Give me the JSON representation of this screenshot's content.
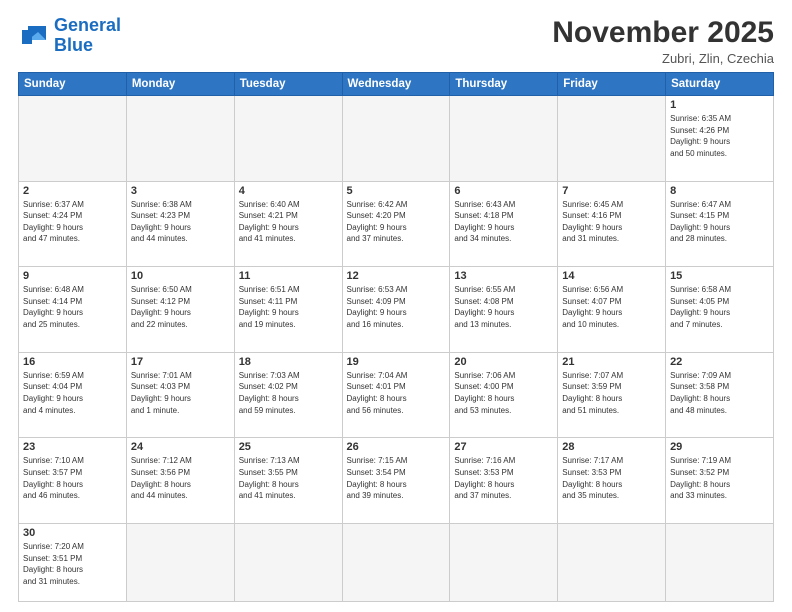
{
  "logo": {
    "general": "General",
    "blue": "Blue"
  },
  "header": {
    "month_year": "November 2025",
    "location": "Zubri, Zlin, Czechia"
  },
  "weekdays": [
    "Sunday",
    "Monday",
    "Tuesday",
    "Wednesday",
    "Thursday",
    "Friday",
    "Saturday"
  ],
  "weeks": [
    [
      {
        "day": "",
        "info": "",
        "empty": true
      },
      {
        "day": "",
        "info": "",
        "empty": true
      },
      {
        "day": "",
        "info": "",
        "empty": true
      },
      {
        "day": "",
        "info": "",
        "empty": true
      },
      {
        "day": "",
        "info": "",
        "empty": true
      },
      {
        "day": "",
        "info": "",
        "empty": true
      },
      {
        "day": "1",
        "info": "Sunrise: 6:35 AM\nSunset: 4:26 PM\nDaylight: 9 hours\nand 50 minutes.",
        "empty": false
      }
    ],
    [
      {
        "day": "2",
        "info": "Sunrise: 6:37 AM\nSunset: 4:24 PM\nDaylight: 9 hours\nand 47 minutes.",
        "empty": false
      },
      {
        "day": "3",
        "info": "Sunrise: 6:38 AM\nSunset: 4:23 PM\nDaylight: 9 hours\nand 44 minutes.",
        "empty": false
      },
      {
        "day": "4",
        "info": "Sunrise: 6:40 AM\nSunset: 4:21 PM\nDaylight: 9 hours\nand 41 minutes.",
        "empty": false
      },
      {
        "day": "5",
        "info": "Sunrise: 6:42 AM\nSunset: 4:20 PM\nDaylight: 9 hours\nand 37 minutes.",
        "empty": false
      },
      {
        "day": "6",
        "info": "Sunrise: 6:43 AM\nSunset: 4:18 PM\nDaylight: 9 hours\nand 34 minutes.",
        "empty": false
      },
      {
        "day": "7",
        "info": "Sunrise: 6:45 AM\nSunset: 4:16 PM\nDaylight: 9 hours\nand 31 minutes.",
        "empty": false
      },
      {
        "day": "8",
        "info": "Sunrise: 6:47 AM\nSunset: 4:15 PM\nDaylight: 9 hours\nand 28 minutes.",
        "empty": false
      }
    ],
    [
      {
        "day": "9",
        "info": "Sunrise: 6:48 AM\nSunset: 4:14 PM\nDaylight: 9 hours\nand 25 minutes.",
        "empty": false
      },
      {
        "day": "10",
        "info": "Sunrise: 6:50 AM\nSunset: 4:12 PM\nDaylight: 9 hours\nand 22 minutes.",
        "empty": false
      },
      {
        "day": "11",
        "info": "Sunrise: 6:51 AM\nSunset: 4:11 PM\nDaylight: 9 hours\nand 19 minutes.",
        "empty": false
      },
      {
        "day": "12",
        "info": "Sunrise: 6:53 AM\nSunset: 4:09 PM\nDaylight: 9 hours\nand 16 minutes.",
        "empty": false
      },
      {
        "day": "13",
        "info": "Sunrise: 6:55 AM\nSunset: 4:08 PM\nDaylight: 9 hours\nand 13 minutes.",
        "empty": false
      },
      {
        "day": "14",
        "info": "Sunrise: 6:56 AM\nSunset: 4:07 PM\nDaylight: 9 hours\nand 10 minutes.",
        "empty": false
      },
      {
        "day": "15",
        "info": "Sunrise: 6:58 AM\nSunset: 4:05 PM\nDaylight: 9 hours\nand 7 minutes.",
        "empty": false
      }
    ],
    [
      {
        "day": "16",
        "info": "Sunrise: 6:59 AM\nSunset: 4:04 PM\nDaylight: 9 hours\nand 4 minutes.",
        "empty": false
      },
      {
        "day": "17",
        "info": "Sunrise: 7:01 AM\nSunset: 4:03 PM\nDaylight: 9 hours\nand 1 minute.",
        "empty": false
      },
      {
        "day": "18",
        "info": "Sunrise: 7:03 AM\nSunset: 4:02 PM\nDaylight: 8 hours\nand 59 minutes.",
        "empty": false
      },
      {
        "day": "19",
        "info": "Sunrise: 7:04 AM\nSunset: 4:01 PM\nDaylight: 8 hours\nand 56 minutes.",
        "empty": false
      },
      {
        "day": "20",
        "info": "Sunrise: 7:06 AM\nSunset: 4:00 PM\nDaylight: 8 hours\nand 53 minutes.",
        "empty": false
      },
      {
        "day": "21",
        "info": "Sunrise: 7:07 AM\nSunset: 3:59 PM\nDaylight: 8 hours\nand 51 minutes.",
        "empty": false
      },
      {
        "day": "22",
        "info": "Sunrise: 7:09 AM\nSunset: 3:58 PM\nDaylight: 8 hours\nand 48 minutes.",
        "empty": false
      }
    ],
    [
      {
        "day": "23",
        "info": "Sunrise: 7:10 AM\nSunset: 3:57 PM\nDaylight: 8 hours\nand 46 minutes.",
        "empty": false
      },
      {
        "day": "24",
        "info": "Sunrise: 7:12 AM\nSunset: 3:56 PM\nDaylight: 8 hours\nand 44 minutes.",
        "empty": false
      },
      {
        "day": "25",
        "info": "Sunrise: 7:13 AM\nSunset: 3:55 PM\nDaylight: 8 hours\nand 41 minutes.",
        "empty": false
      },
      {
        "day": "26",
        "info": "Sunrise: 7:15 AM\nSunset: 3:54 PM\nDaylight: 8 hours\nand 39 minutes.",
        "empty": false
      },
      {
        "day": "27",
        "info": "Sunrise: 7:16 AM\nSunset: 3:53 PM\nDaylight: 8 hours\nand 37 minutes.",
        "empty": false
      },
      {
        "day": "28",
        "info": "Sunrise: 7:17 AM\nSunset: 3:53 PM\nDaylight: 8 hours\nand 35 minutes.",
        "empty": false
      },
      {
        "day": "29",
        "info": "Sunrise: 7:19 AM\nSunset: 3:52 PM\nDaylight: 8 hours\nand 33 minutes.",
        "empty": false
      }
    ],
    [
      {
        "day": "30",
        "info": "Sunrise: 7:20 AM\nSunset: 3:51 PM\nDaylight: 8 hours\nand 31 minutes.",
        "empty": false
      },
      {
        "day": "",
        "info": "",
        "empty": true
      },
      {
        "day": "",
        "info": "",
        "empty": true
      },
      {
        "day": "",
        "info": "",
        "empty": true
      },
      {
        "day": "",
        "info": "",
        "empty": true
      },
      {
        "day": "",
        "info": "",
        "empty": true
      },
      {
        "day": "",
        "info": "",
        "empty": true
      }
    ]
  ]
}
